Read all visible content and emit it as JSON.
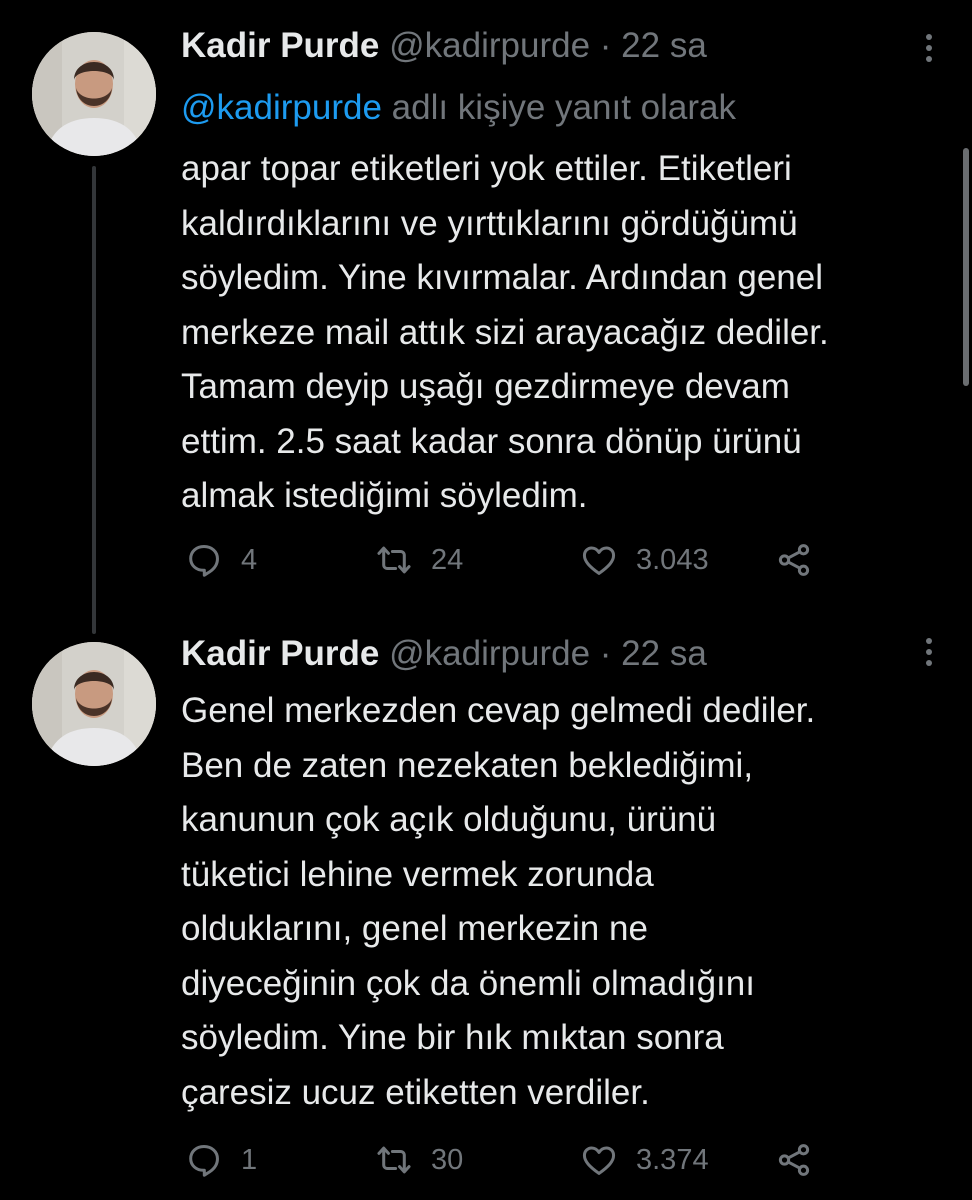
{
  "tweets": [
    {
      "author_name": "Kadir Purde",
      "handle": "@kadirpurde",
      "separator": "·",
      "time": "22 sa",
      "reply_mention": "@kadirpurde",
      "reply_suffix": " adlı kişiye yanıt olarak",
      "text": "apar topar etiketleri yok ettiler. Etiketleri\nkaldırdıklarını ve yırttıklarını gördüğümü\nsöyledim. Yine kıvırmalar. Ardından genel\nmerkeze mail attık sizi arayacağız dediler.\nTamam deyip uşağı gezdirmeye devam\nettim. 2.5 saat kadar sonra dönüp ürünü\nalmak istediğimi söyledim.",
      "reply_count": "4",
      "retweet_count": "24",
      "like_count": "3.043"
    },
    {
      "author_name": "Kadir Purde",
      "handle": "@kadirpurde",
      "separator": "·",
      "time": "22 sa",
      "text": "Genel merkezden cevap gelmedi dediler.\nBen de zaten nezekaten beklediğimi,\nkanunun çok açık olduğunu, ürünü\ntüketici lehine vermek zorunda\nolduklarını, genel merkezin ne\ndiyeceğinin çok da önemli olmadığını\nsöyledim. Yine bir hık mıktan sonra\nçaresiz ucuz etiketten verdiler.",
      "reply_count": "1",
      "retweet_count": "30",
      "like_count": "3.374"
    }
  ],
  "icons": {
    "reply": "reply-icon",
    "retweet": "retweet-icon",
    "like": "heart-icon",
    "share": "share-icon",
    "more": "more-options-icon"
  },
  "colors": {
    "background": "#000000",
    "text": "#e7e9ea",
    "secondary": "#71767b",
    "accent": "#1d9bf0",
    "thread_line": "#333639"
  }
}
